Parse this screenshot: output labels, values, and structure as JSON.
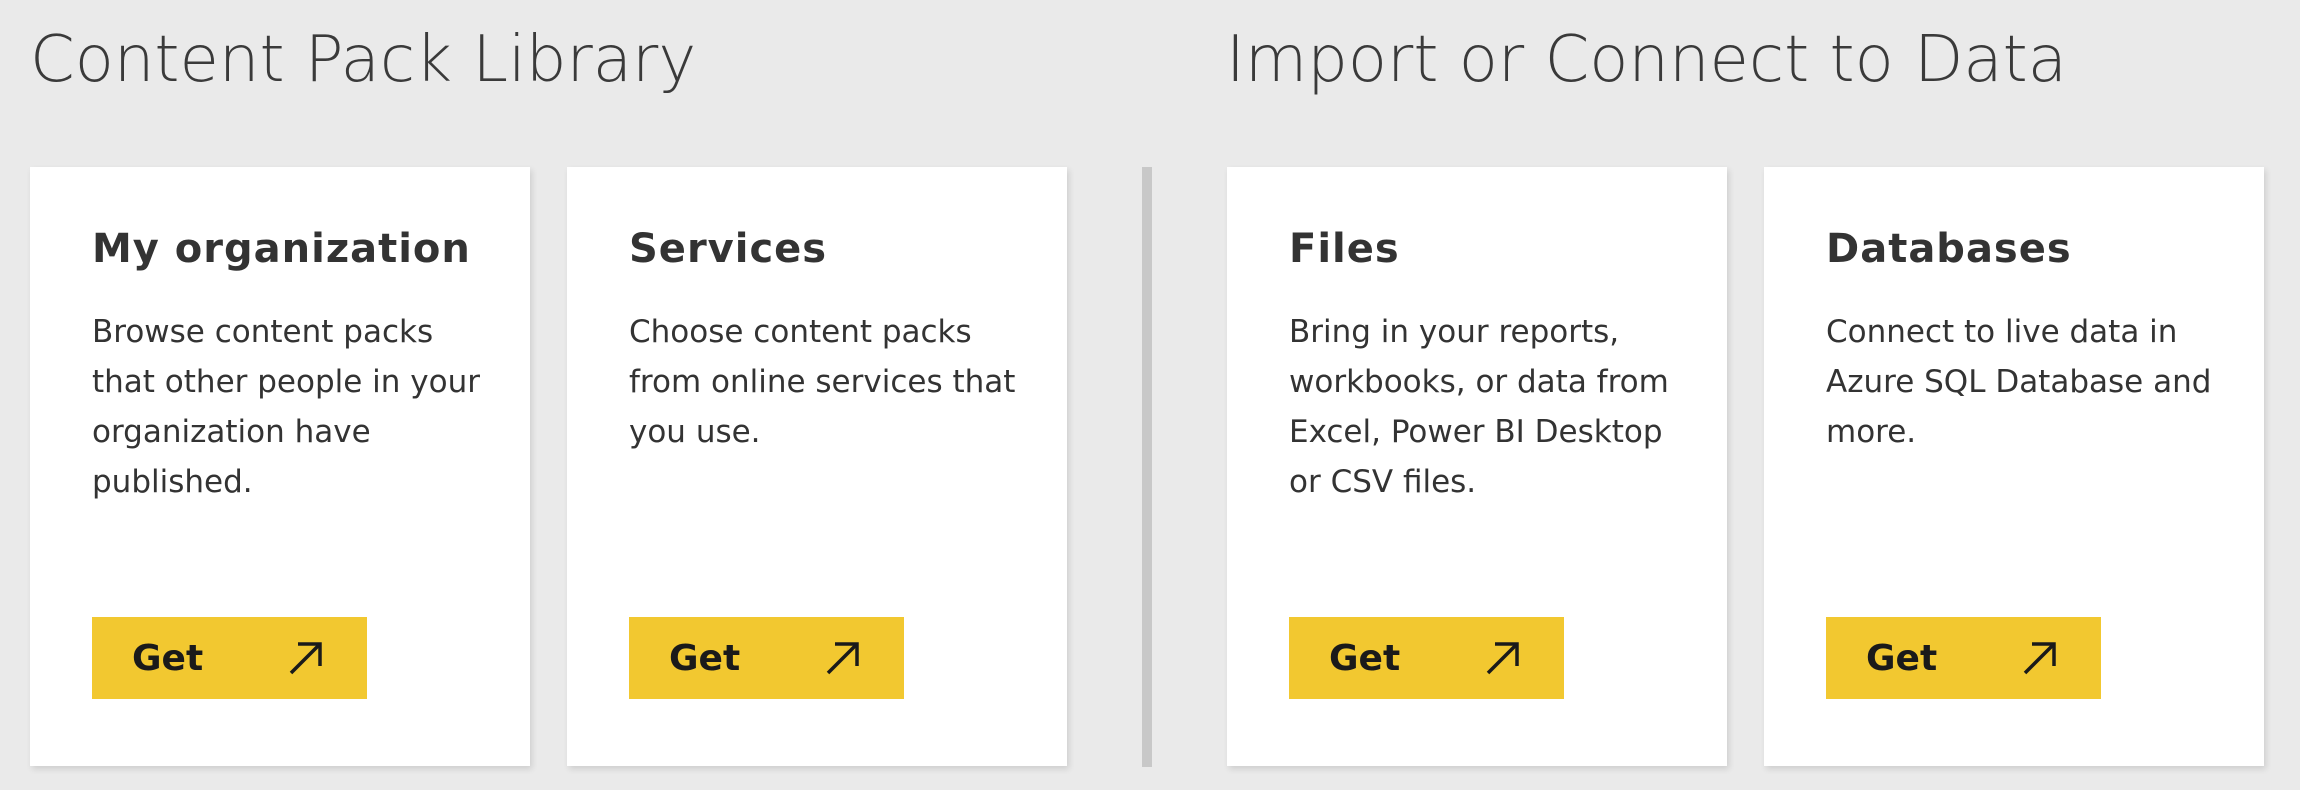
{
  "sections": {
    "library_title": "Content Pack Library",
    "import_title": "Import or Connect to Data"
  },
  "cards": [
    {
      "title": "My organization",
      "description": "Browse content packs that other people in your organization have published.",
      "button_label": "Get",
      "button_icon": "arrow-up-right-icon"
    },
    {
      "title": "Services",
      "description": "Choose content packs from online services that you use.",
      "button_label": "Get",
      "button_icon": "arrow-up-right-icon"
    },
    {
      "title": "Files",
      "description": "Bring in your reports, workbooks, or data from Excel, Power BI Desktop or CSV files.",
      "button_label": "Get",
      "button_icon": "arrow-up-right-icon"
    },
    {
      "title": "Databases",
      "description": "Connect to live data in Azure SQL Database and more.",
      "button_label": "Get",
      "button_icon": "arrow-up-right-icon"
    }
  ],
  "colors": {
    "background": "#eaeaea",
    "card": "#ffffff",
    "accent": "#f2c830",
    "text": "#333333",
    "divider": "#c8c8c8"
  }
}
